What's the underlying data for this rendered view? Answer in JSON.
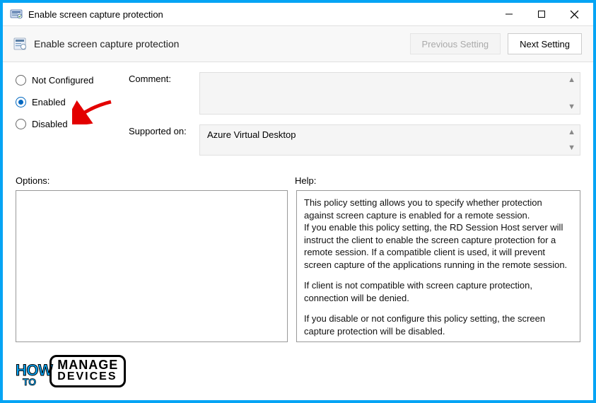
{
  "window": {
    "title": "Enable screen capture protection"
  },
  "header": {
    "title": "Enable screen capture protection",
    "prev_label": "Previous Setting",
    "next_label": "Next Setting"
  },
  "radios": {
    "not_configured": "Not Configured",
    "enabled": "Enabled",
    "disabled": "Disabled",
    "selected": "enabled"
  },
  "fields": {
    "comment_label": "Comment:",
    "comment_value": "",
    "supported_label": "Supported on:",
    "supported_value": "Azure Virtual Desktop"
  },
  "sections": {
    "options_label": "Options:",
    "help_label": "Help:"
  },
  "help": {
    "p1": "This policy setting allows you to specify whether protection against screen capture is enabled for a remote session.",
    "p2": "If you enable this policy setting, the RD Session Host server will instruct the client to enable the screen capture protection for a remote session. If a compatible client is used, it will prevent screen capture of the applications running in the remote session.",
    "p3": "If client is not compatible with screen capture protection, connection will be denied.",
    "p4": "If you disable or not configure this policy setting, the screen capture protection will be disabled."
  },
  "watermark": {
    "how": "HOW",
    "to": "TO",
    "manage": "MANAGE",
    "devices": "DEVICES"
  }
}
